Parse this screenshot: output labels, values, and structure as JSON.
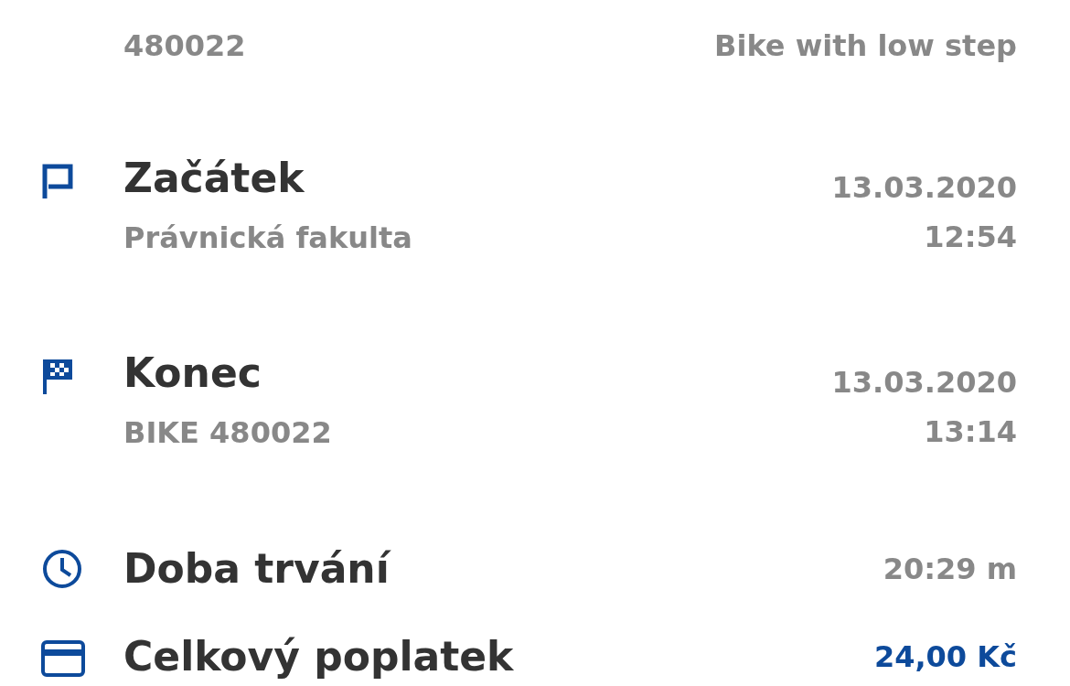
{
  "rows": [
    {
      "kind": "vehicle",
      "subtitle": "480022",
      "values": [
        "Bike with low step"
      ]
    },
    {
      "kind": "start",
      "title": "Začátek",
      "subtitle": "Právnická fakulta",
      "values": [
        "13.03.2020",
        "12:54"
      ]
    },
    {
      "kind": "end",
      "title": "Konec",
      "subtitle": "BIKE 480022",
      "values": [
        "13.03.2020",
        "13:14"
      ]
    },
    {
      "kind": "duration",
      "title": "Doba trvání",
      "values": [
        "20:29 m"
      ]
    },
    {
      "kind": "fee",
      "title": "Celkový poplatek",
      "values": [
        "24,00 Kč"
      ]
    }
  ]
}
